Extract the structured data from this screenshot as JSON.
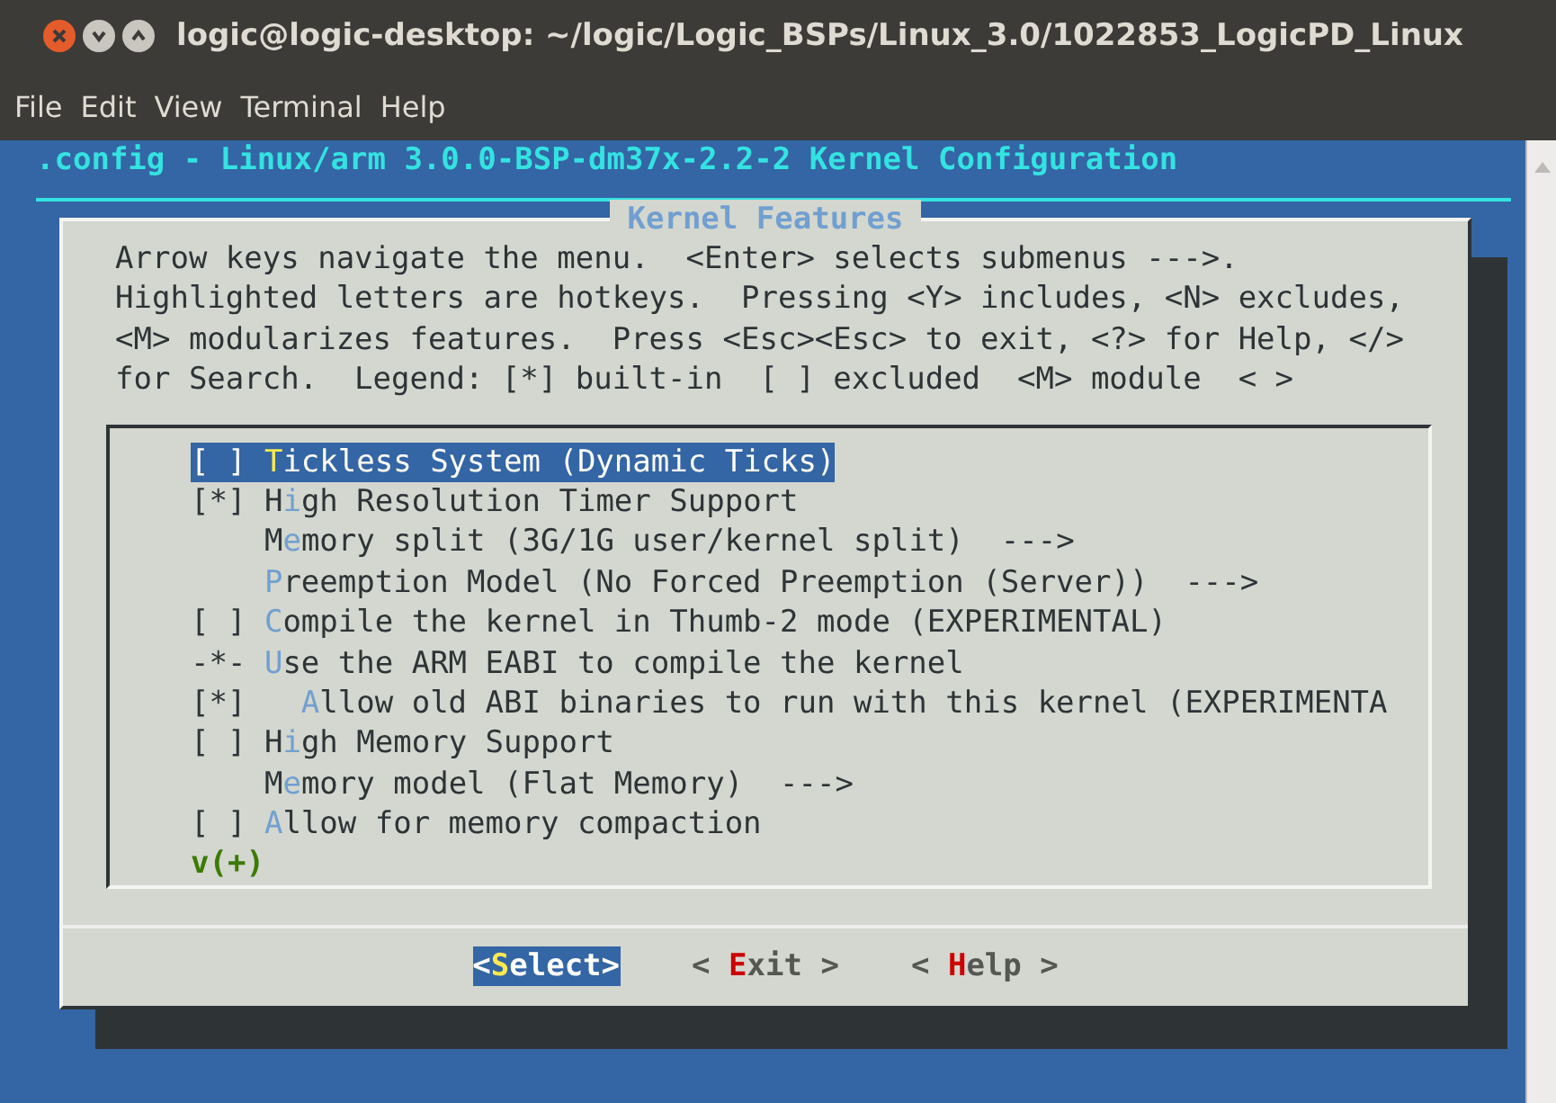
{
  "window": {
    "title": "logic@logic-desktop: ~/logic/Logic_BSPs/Linux_3.0/1022853_LogicPD_Linux"
  },
  "menu_bar": [
    "File",
    "Edit",
    "View",
    "Terminal",
    "Help"
  ],
  "header": ".config - Linux/arm 3.0.0-BSP-dm37x-2.2-2 Kernel Configuration",
  "dialog": {
    "title": "Kernel Features",
    "help_lines": [
      "Arrow keys navigate the menu.  <Enter> selects submenus --->.",
      "Highlighted letters are hotkeys.  Pressing <Y> includes, <N> excludes,",
      "<M> modularizes features.  Press <Esc><Esc> to exit, <?> for Help, </>",
      "for Search.  Legend: [*] built-in  [ ] excluded  <M> module  < >"
    ],
    "items": [
      {
        "prefix": "[ ]",
        "hotkey": "T",
        "after": "ickless System (Dynamic Ticks)",
        "selected": true
      },
      {
        "prefix": "[*]",
        "before": "H",
        "hotkey": "i",
        "after": "gh Resolution Timer Support",
        "selected": false
      },
      {
        "before": "M",
        "hotkey": "e",
        "after": "mory split (3G/1G user/kernel split)  --->",
        "selected": false
      },
      {
        "hotkey": "P",
        "after": "reemption Model (No Forced Preemption (Server))  --->",
        "selected": false
      },
      {
        "prefix": "[ ]",
        "hotkey": "C",
        "after": "ompile the kernel in Thumb-2 mode (EXPERIMENTAL)",
        "selected": false
      },
      {
        "prefix": "-*-",
        "hotkey": "U",
        "after": "se the ARM EABI to compile the kernel",
        "selected": false,
        "children": [
          {
            "prefix": "[*]",
            "hotkey": "A",
            "after": "llow old ABI binaries to run with this kernel (EXPERIMENTA",
            "selected": false
          }
        ]
      },
      {
        "prefix": "[ ]",
        "before": "H",
        "hotkey": "i",
        "after": "gh Memory Support",
        "selected": false
      },
      {
        "before": "M",
        "hotkey": "e",
        "after": "mory model (Flat Memory)  --->",
        "selected": false
      },
      {
        "prefix": "[ ]",
        "hotkey": "A",
        "after": "llow for memory compaction",
        "selected": false
      }
    ],
    "more_indicator": "v(+)",
    "buttons": [
      {
        "before": "<",
        "hotkey": "S",
        "after": "elect>",
        "selected": true
      },
      {
        "before": "< ",
        "hotkey": "E",
        "after": "xit >",
        "selected": false
      },
      {
        "before": "< ",
        "hotkey": "H",
        "after": "elp >",
        "selected": false
      }
    ]
  }
}
